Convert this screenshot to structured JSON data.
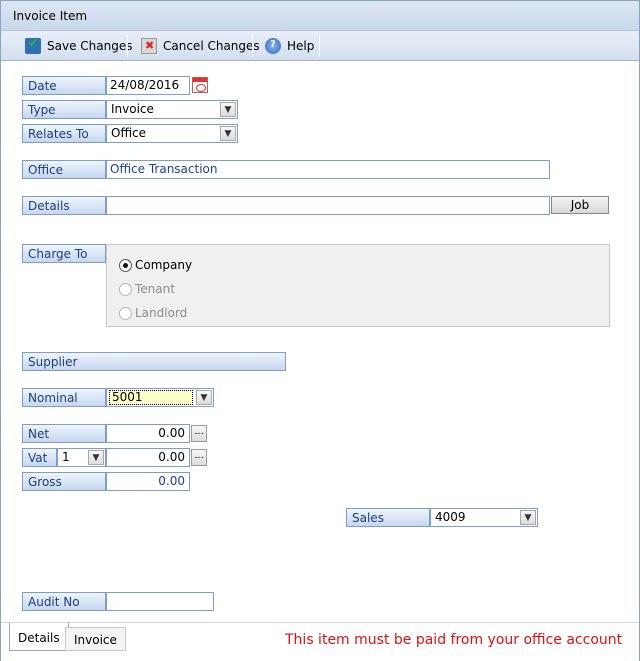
{
  "window": {
    "title": "Invoice Item"
  },
  "toolbar": {
    "save_label": "Save Changes",
    "cancel_label": "Cancel Changes",
    "help_label": "Help"
  },
  "form": {
    "date": {
      "label": "Date",
      "value": "24/08/2016"
    },
    "type": {
      "label": "Type",
      "value": "Invoice"
    },
    "relates_to": {
      "label": "Relates To",
      "value": "Office"
    },
    "office": {
      "label": "Office",
      "value": "Office Transaction"
    },
    "details": {
      "label": "Details",
      "value": "",
      "job_button": "Job"
    },
    "charge_to": {
      "label": "Charge To",
      "options": [
        {
          "label": "Company",
          "selected": true,
          "enabled": true
        },
        {
          "label": "Tenant",
          "selected": false,
          "enabled": false
        },
        {
          "label": "Landlord",
          "selected": false,
          "enabled": false
        }
      ]
    },
    "supplier": {
      "label": "Supplier"
    },
    "nominal": {
      "label": "Nominal",
      "value": "5001",
      "highlight_color": "#ffffc8"
    },
    "net": {
      "label": "Net",
      "value": "0.00"
    },
    "vat": {
      "label": "Vat",
      "rate": "1",
      "value": "0.00"
    },
    "gross": {
      "label": "Gross",
      "value": "0.00"
    },
    "sales": {
      "label": "Sales",
      "value": "4009"
    },
    "audit_no": {
      "label": "Audit No",
      "value": ""
    }
  },
  "tabs": [
    {
      "label": "Details",
      "active": true
    },
    {
      "label": "Invoice",
      "active": false
    }
  ],
  "notice": {
    "text": "This item must be paid from your office account",
    "color": "#e01010"
  }
}
